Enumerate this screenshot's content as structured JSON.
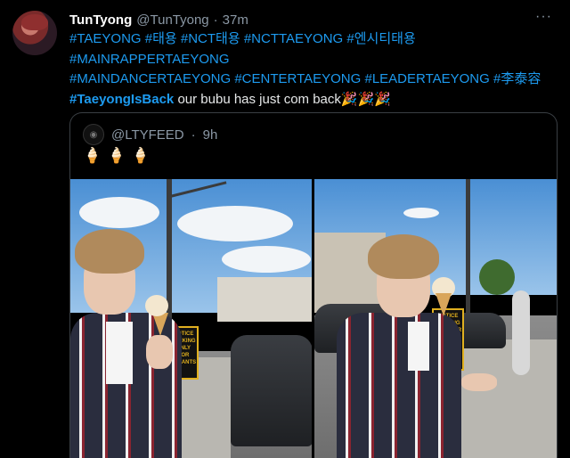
{
  "tweet": {
    "display_name": "TunTyong",
    "handle": "@TunTyong",
    "separator": "·",
    "time": "37m",
    "more": "···",
    "text_parts": [
      {
        "t": "#TAEYONG",
        "type": "tag"
      },
      {
        "t": " ",
        "type": "text"
      },
      {
        "t": "#태용",
        "type": "tag"
      },
      {
        "t": " ",
        "type": "text"
      },
      {
        "t": "#NCT태용",
        "type": "tag"
      },
      {
        "t": " ",
        "type": "text"
      },
      {
        "t": "#NCTTAEYONG",
        "type": "tag"
      },
      {
        "t": " ",
        "type": "text"
      },
      {
        "t": "#엔시티태용",
        "type": "tag"
      },
      {
        "t": " ",
        "type": "br"
      },
      {
        "t": "#MAINRAPPERTAEYONG",
        "type": "tag"
      },
      {
        "t": " ",
        "type": "br"
      },
      {
        "t": "#MAINDANCERTAEYONG",
        "type": "tag"
      },
      {
        "t": " ",
        "type": "text"
      },
      {
        "t": "#CENTERTAEYONG",
        "type": "tag"
      },
      {
        "t": " ",
        "type": "text"
      },
      {
        "t": "#LEADERTAEYONG",
        "type": "tag"
      },
      {
        "t": " ",
        "type": "text"
      },
      {
        "t": "#李泰容",
        "type": "tag"
      },
      {
        "t": " ",
        "type": "br"
      },
      {
        "t": "#TaeyongIsBack",
        "type": "tag-bold"
      },
      {
        "t": " our bubu has just com back",
        "type": "text"
      },
      {
        "t": "🎉🎉🎉",
        "type": "text"
      }
    ]
  },
  "quote": {
    "handle": "@LTYFEED",
    "separator": "·",
    "time": "9h",
    "emoji": "🍦🍦🍦",
    "photos": [
      "photo-left",
      "photo-right"
    ]
  },
  "colors": {
    "background": "#000000",
    "link": "#1d9bf0",
    "muted": "#8b98a5",
    "border": "#3a3f44"
  }
}
